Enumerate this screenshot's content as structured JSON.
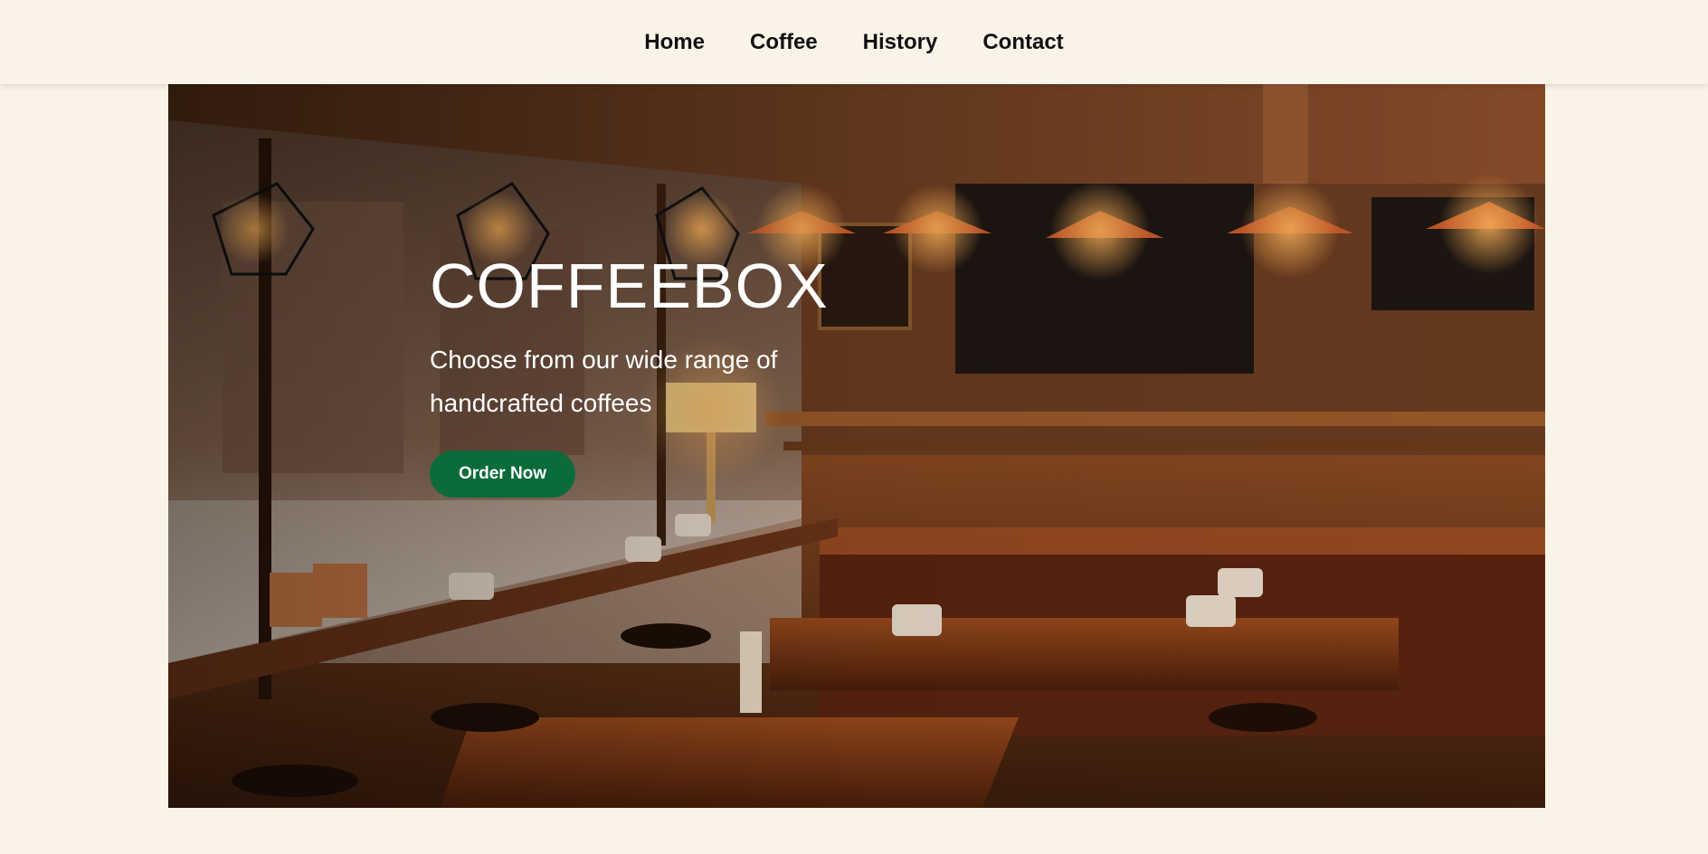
{
  "nav": {
    "items": [
      {
        "label": "Home"
      },
      {
        "label": "Coffee"
      },
      {
        "label": "History"
      },
      {
        "label": "Contact"
      }
    ]
  },
  "hero": {
    "title": "COFFEEBOX",
    "subtitle": "Choose from our wide range of handcrafted coffees",
    "cta_label": "Order Now",
    "image_alt": "Cozy coffee shop interior with pendant lamps and candles"
  },
  "colors": {
    "background": "#faf3e8",
    "nav_text": "#111111",
    "cta": "#0b6b3a",
    "hero_text": "#ffffff"
  }
}
